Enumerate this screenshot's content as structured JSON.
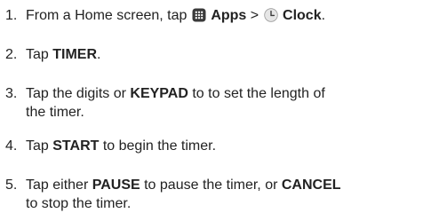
{
  "steps": [
    {
      "number": "1.",
      "prefix": "From a Home screen, tap",
      "apps_label": "Apps",
      "separator": ">",
      "clock_label": "Clock",
      "suffix": ".",
      "apps_icon": "apps-grid-icon",
      "clock_icon": "clock-icon"
    },
    {
      "number": "2.",
      "prefix": "Tap",
      "bold": "TIMER",
      "suffix": "."
    },
    {
      "number": "3.",
      "prefix": "Tap the digits or",
      "bold": "KEYPAD",
      "line1_rest": "to to set the length of",
      "line2": "the timer."
    },
    {
      "number": "4.",
      "prefix": "Tap",
      "bold": "START",
      "suffix": "to begin the timer."
    },
    {
      "number": "5.",
      "prefix": "Tap either",
      "bold1": "PAUSE",
      "middle": "to pause the timer, or",
      "bold2": "CANCEL",
      "line2": "to stop the timer."
    }
  ],
  "colors": {
    "text": "#222222",
    "apps_icon_bg": "#3a3a3a",
    "clock_icon_bg": "#e6e6e6"
  }
}
